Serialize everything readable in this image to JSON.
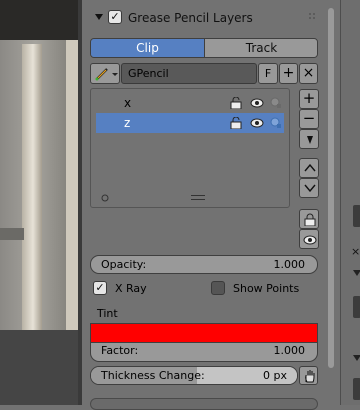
{
  "panel": {
    "title": "Grease Pencil Layers",
    "header_enabled": true,
    "tabs": [
      {
        "label": "Clip",
        "active": true
      },
      {
        "label": "Track",
        "active": false
      }
    ],
    "datablock": {
      "name": "GPencil",
      "fake_user_label": "F",
      "add_label": "+",
      "remove_label": "×"
    },
    "layers": [
      {
        "name": "x",
        "selected": false
      },
      {
        "name": "z",
        "selected": true
      }
    ],
    "list_add": "+",
    "list_remove": "−",
    "opacity": {
      "label": "Opacity:",
      "value": "1.000"
    },
    "xray": {
      "label": "X Ray",
      "checked": true
    },
    "show_points": {
      "label": "Show Points",
      "checked": false
    },
    "tint": {
      "label": "Tint",
      "color": "#ff0000"
    },
    "factor": {
      "label": "Factor:",
      "value": "1.000"
    },
    "thickness": {
      "label": "Thickness Change:",
      "value": "0 px"
    }
  },
  "colors": {
    "accent": "#5680c2",
    "panel_bg": "#727272",
    "tint": "#ff0000"
  },
  "icons": [
    "chevron-down-icon",
    "brush-icon",
    "lock-icon",
    "eye-icon",
    "onion-skin-icon",
    "arrow-up-icon",
    "arrow-down-icon",
    "move-down-icon",
    "grip-icon"
  ]
}
